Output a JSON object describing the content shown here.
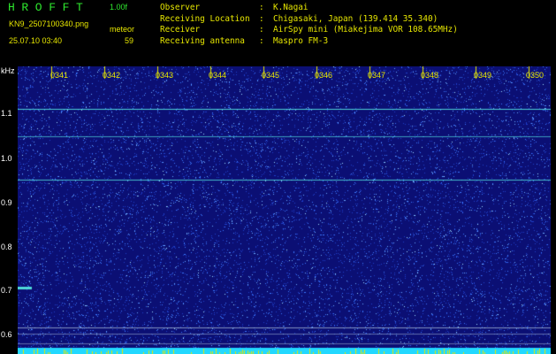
{
  "header": {
    "app_title": "HROFFT",
    "version": "1.00f",
    "filename": "KN9_2507100340.png",
    "mode": "meteor",
    "timestamp": "25.07.10 03:40",
    "count": "59"
  },
  "station_info": [
    {
      "label": "Observer",
      "sep": ":",
      "value": "K.Nagai"
    },
    {
      "label": "Receiving Location",
      "sep": ":",
      "value": "Chigasaki, Japan (139.414 35.340)"
    },
    {
      "label": "Receiver",
      "sep": ":",
      "value": "AirSpy mini (Miakejima VOR 108.65MHz)"
    },
    {
      "label": "Receiving antenna",
      "sep": ":",
      "value": "Maspro FM-3"
    }
  ],
  "y_axis": {
    "unit": "kHz",
    "ticks": [
      "1.1",
      "1.0",
      "0.9",
      "0.8",
      "0.7",
      "0.6"
    ]
  },
  "x_axis": {
    "ticks": [
      "0341",
      "0342",
      "0343",
      "0344",
      "0345",
      "0346",
      "0347",
      "0348",
      "0349",
      "0350"
    ]
  },
  "colors": {
    "background": "#0b0f74",
    "noise": "#3a78ff",
    "carrier": "#4fd8d8",
    "marker": "#e6e600",
    "text_green": "#2ee82e",
    "text_yellow": "#e6e600"
  }
}
